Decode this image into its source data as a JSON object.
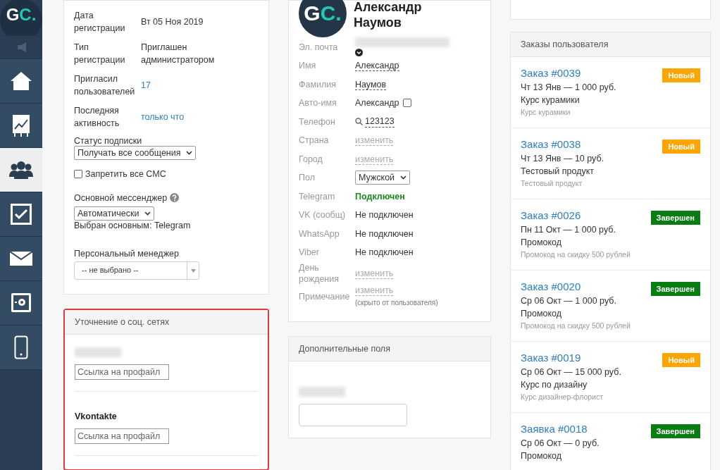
{
  "sidebar": {
    "logo": {
      "first": "G",
      "rest": "C."
    },
    "items": [
      {
        "kind": "speaker",
        "selected": false
      },
      {
        "kind": "home",
        "selected": false
      },
      {
        "kind": "chart",
        "selected": false
      },
      {
        "kind": "users",
        "selected": true
      },
      {
        "kind": "tasks",
        "selected": false
      },
      {
        "kind": "mail",
        "selected": false
      },
      {
        "kind": "safe",
        "selected": false
      },
      {
        "kind": "phone",
        "selected": false
      }
    ]
  },
  "user_info": {
    "rows": [
      {
        "label": "Дата регистрации",
        "value": "Вт 05 Ноя 2019",
        "kind": "text"
      },
      {
        "label": "Тип регистрации",
        "value": "Приглашен администратором",
        "kind": "text"
      },
      {
        "label": "Пригласил пользователей",
        "value": "17",
        "kind": "link"
      },
      {
        "label": "Последняя активность",
        "value": "только что",
        "kind": "link"
      }
    ],
    "subscription": {
      "label": "Статус подписки",
      "value": "Получать все сообщения"
    },
    "block_sms": {
      "label": "Запретить все СМС",
      "checked": false
    },
    "messenger": {
      "label": "Основной мессенджер",
      "value": "Автоматически",
      "note": "Выбран основным: Telegram"
    },
    "manager": {
      "label": "Персональный менеджер",
      "value": "-- не выбрано --"
    }
  },
  "social_card": {
    "title": "Уточнение о соц. сетях",
    "highlighted": true,
    "networks": [
      {
        "kind": "redacted",
        "placeholder": "Ссылка на профайл"
      },
      {
        "kind": "named",
        "name": "Vkontakte",
        "placeholder": "Ссылка на профайл"
      }
    ]
  },
  "profile": {
    "avatar": {
      "first": "G",
      "rest": "C."
    },
    "name": "Александр Наумов",
    "fields": [
      {
        "label": "Эл. почта",
        "kind": "email"
      },
      {
        "label": "Имя",
        "kind": "editable",
        "value": "Александр"
      },
      {
        "label": "Фамилия",
        "kind": "editable",
        "value": "Наумов"
      },
      {
        "label": "Авто-имя",
        "kind": "checkbox",
        "value": "Александр",
        "checked": false
      },
      {
        "label": "Телефон",
        "kind": "phone",
        "value": "123123"
      },
      {
        "label": "Страна",
        "kind": "change",
        "value": "изменить"
      },
      {
        "label": "Город",
        "kind": "change",
        "value": "изменить"
      },
      {
        "label": "Пол",
        "kind": "select",
        "value": "Мужской"
      },
      {
        "label": "Telegram",
        "kind": "status",
        "value": "Подключен",
        "connected": true
      },
      {
        "label": "VK (сообщ)",
        "kind": "status",
        "value": "Не подключен",
        "connected": false
      },
      {
        "label": "WhatsApp",
        "kind": "status",
        "value": "Не подключен",
        "connected": false
      },
      {
        "label": "Viber",
        "kind": "status",
        "value": "Не подключен",
        "connected": false
      },
      {
        "label": "День рождения",
        "kind": "change",
        "value": "изменить"
      },
      {
        "label": "Примечание",
        "kind": "note",
        "value": "изменить",
        "note": "(скрыто от пользователя)"
      }
    ]
  },
  "extra_fields": {
    "title": "Дополнительные поля"
  },
  "orders": {
    "title": "Заказы пользователя",
    "items": [
      {
        "title": "Заказ #0039",
        "line": "Чт 13 Янв — 1 000 руб.",
        "product": "Курс курамики",
        "offer": "Курс курамики",
        "status": "Новый",
        "color": "#ffa500"
      },
      {
        "title": "Заказ #0038",
        "line": "Чт 13 Янв — 10 руб.",
        "product": "Тестовый продукт",
        "offer": "Тестовый продукт",
        "status": "Новый",
        "color": "#ffa500"
      },
      {
        "title": "Заказ #0026",
        "line": "Пн 11 Окт — 1 000 руб.",
        "product": "Промокод",
        "offer": "Промокод на скидку 500 рублей",
        "status": "Завершен",
        "color": "#0a7d12"
      },
      {
        "title": "Заказ #0020",
        "line": "Ср 06 Окт — 1 000 руб.",
        "product": "Промокод",
        "offer": "Промокод на скидку 500 рублей",
        "status": "Завершен",
        "color": "#0a7d12"
      },
      {
        "title": "Заказ #0019",
        "line": "Ср 06 Окт — 15 000 руб.",
        "product": "Курс по дизайну",
        "offer": "Курс дизайнер-флорист",
        "status": "Новый",
        "color": "#ffa500"
      },
      {
        "title": "Заявка #0018",
        "line": "Ср 06 Окт — 0 руб.",
        "product": "Промокод",
        "status": "Завершен",
        "color": "#0a7d12"
      }
    ]
  }
}
